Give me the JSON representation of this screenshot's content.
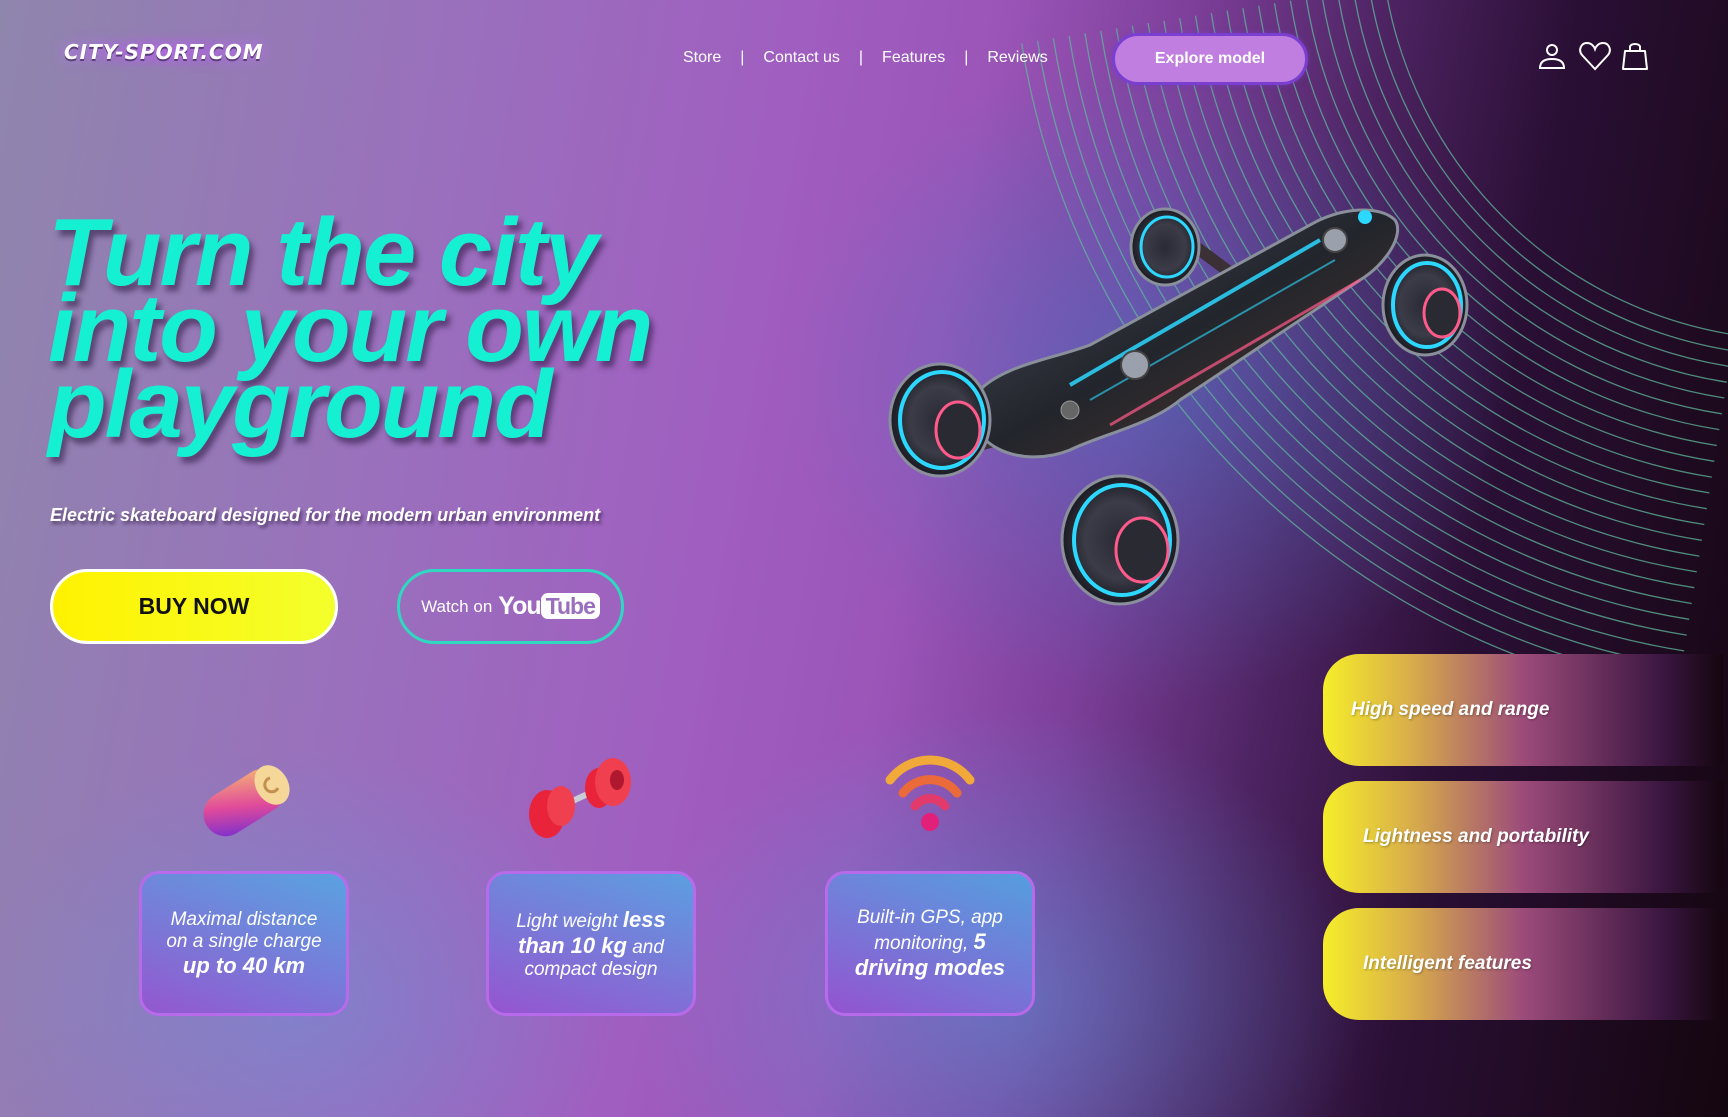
{
  "header": {
    "logo": "CITY-SPORT.COM",
    "nav": [
      {
        "label": "Store"
      },
      {
        "label": "Contact us"
      },
      {
        "label": "Features"
      },
      {
        "label": "Reviews"
      }
    ],
    "separator": "|",
    "explore_label": "Explore model",
    "icons": [
      "user-icon",
      "heart-icon",
      "shopping-bag-icon"
    ]
  },
  "hero": {
    "title_lines": [
      "Turn the city",
      "into your own",
      "playground"
    ],
    "subtitle": "Electric skateboard designed for the modern urban environment",
    "buy_label": "BUY NOW",
    "watch_prefix": "Watch on",
    "youtube_you": "You",
    "youtube_tube": "Tube"
  },
  "features": [
    {
      "icon": "battery-icon",
      "line1": "Maximal distance",
      "line2": "on a single charge",
      "big": "up to 40 km"
    },
    {
      "icon": "dumbbell-icon",
      "pre": "Light weight",
      "big1": "less",
      "big2": "than 10 kg",
      "post": "and",
      "line3": "compact design"
    },
    {
      "icon": "wifi-icon",
      "line1": "Built-in GPS, app",
      "line2": "monitoring,",
      "big1": "5",
      "big2": "driving modes"
    }
  ],
  "highlights": [
    "High speed and range",
    "Lightness and portability",
    "Intelligent features"
  ],
  "colors": {
    "accent_cyan": "#16f0d2",
    "buy_yellow": "#fff200",
    "explore_purple": "#c07ee0"
  }
}
